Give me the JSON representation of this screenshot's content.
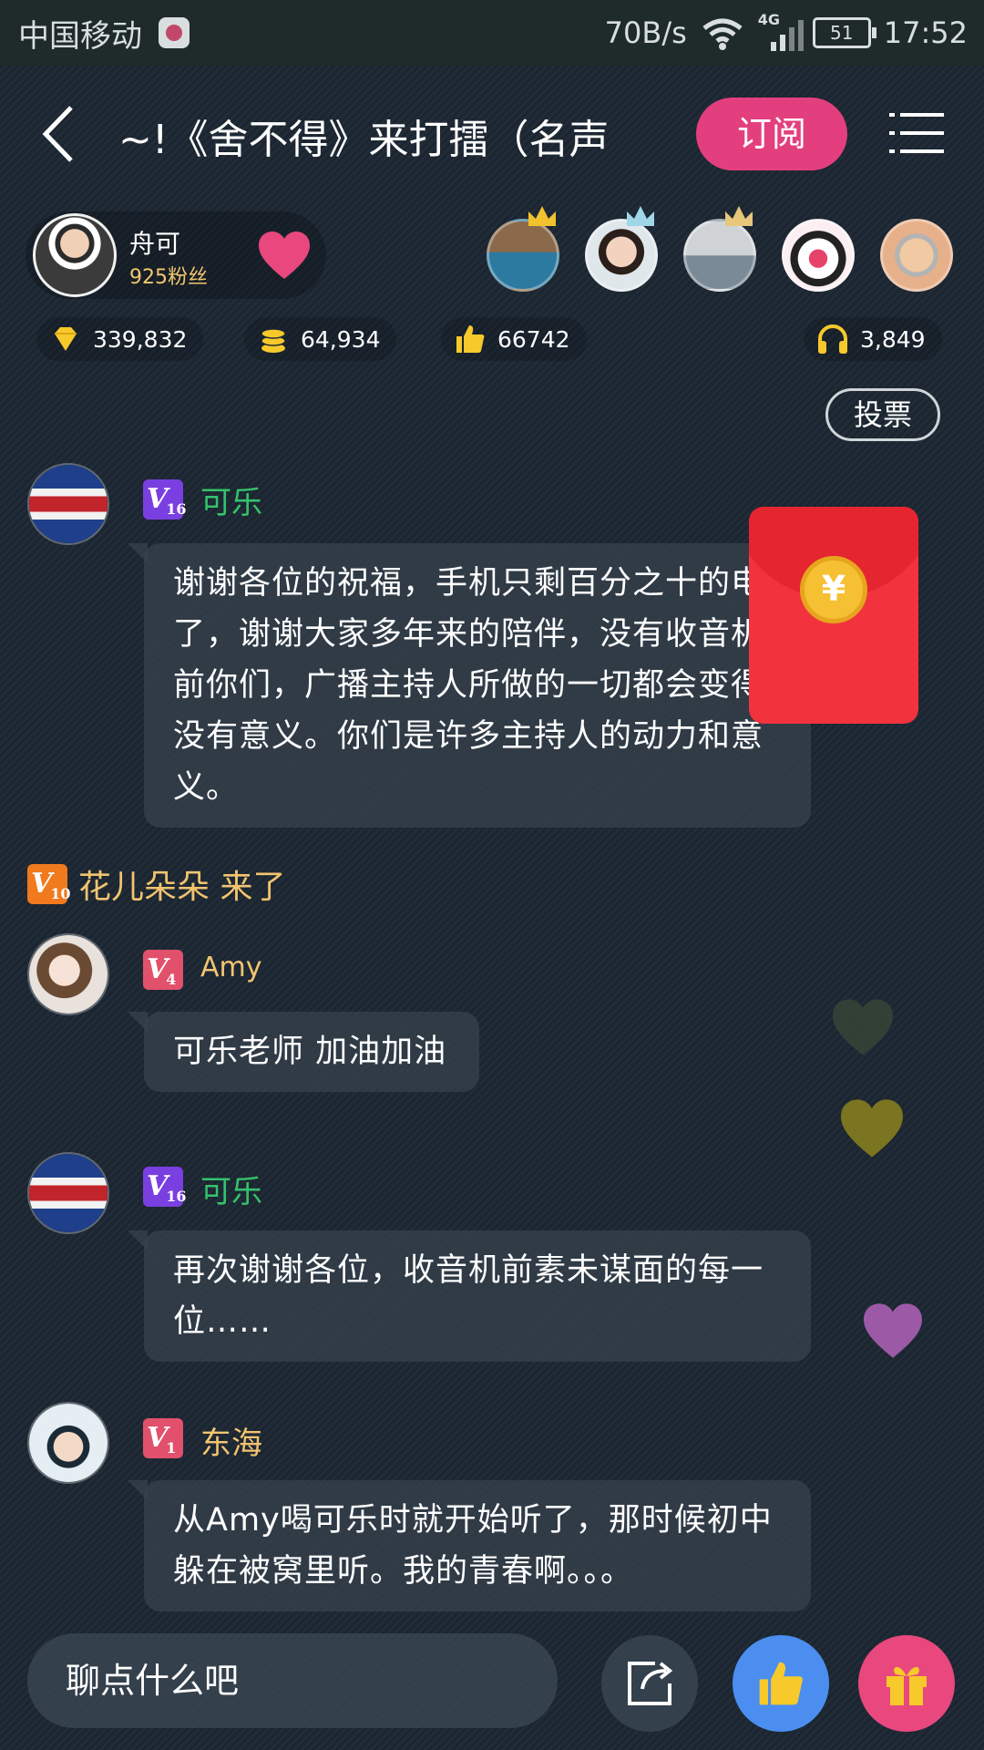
{
  "status_bar": {
    "carrier": "中国移动",
    "speed": "70B/s",
    "network": "4G",
    "battery": "51",
    "time": "17:52"
  },
  "header": {
    "title": "~!《舍不得》来打擂（名声",
    "subscribe_label": "订阅"
  },
  "host": {
    "name": "舟可",
    "fans": "925粉丝"
  },
  "stats": {
    "diamonds": "339,832",
    "coins": "64,934",
    "likes": "66742",
    "listeners": "3,849"
  },
  "vote_label": "投票",
  "messages": [
    {
      "user": "可乐",
      "level": "16",
      "text": "谢谢各位的祝福，手机只剩百分之十的电了，谢谢大家多年来的陪伴，没有收音机前你们，广播主持人所做的一切都会变得没有意义。你们是许多主持人的动力和意义。"
    },
    {
      "user": "Amy",
      "level": "4",
      "text": "可乐老师 加油加油"
    },
    {
      "user": "可乐",
      "level": "16",
      "text": "再次谢谢各位，收音机前素未谋面的每一位……"
    },
    {
      "user": "东海",
      "level": "1",
      "text": "从Amy喝可乐时就开始听了，那时候初中躲在被窝里听。我的青春啊。。。"
    }
  ],
  "join": {
    "level": "10",
    "text": "花儿朵朵 来了"
  },
  "red_packet_symbol": "¥",
  "input_placeholder": "聊点什么吧",
  "colors": {
    "accent_pink": "#e33f7e",
    "name_green": "#34c26b",
    "name_gold": "#f2c46f",
    "vip_purple": "#7a3fe0",
    "like_blue": "#4b8ef0"
  }
}
